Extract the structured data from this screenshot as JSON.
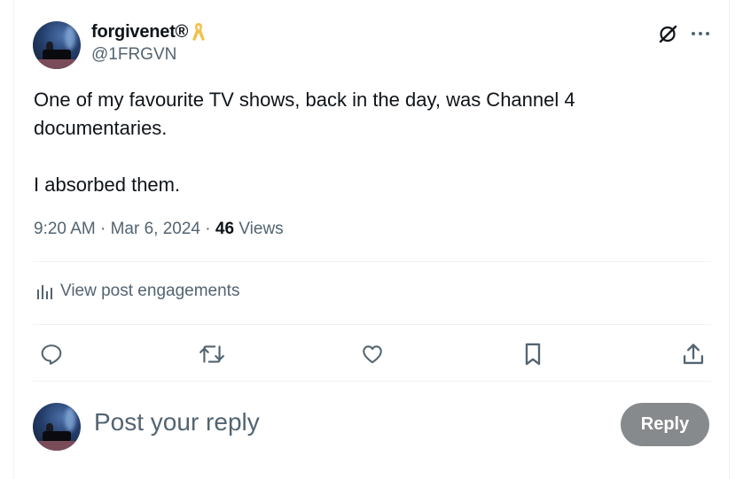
{
  "author": {
    "display_name": "forgivenet®",
    "handle": "@1FRGVN",
    "badge_icon": "yellow-ribbon-icon"
  },
  "post": {
    "lines": [
      "One of my favourite TV shows, back in the day, was Channel 4 documentaries.",
      "I absorbed them."
    ],
    "time": "9:20 AM",
    "date": "Mar 6, 2024",
    "views_count": "46",
    "views_label": "Views"
  },
  "engagements": {
    "label": "View post engagements",
    "icon": "analytics-icon"
  },
  "actions": [
    {
      "icon": "reply-icon"
    },
    {
      "icon": "repost-icon"
    },
    {
      "icon": "like-icon"
    },
    {
      "icon": "bookmark-icon"
    },
    {
      "icon": "share-icon"
    }
  ],
  "composer": {
    "placeholder": "Post your reply",
    "button_label": "Reply"
  },
  "colors": {
    "text_primary": "#0f1419",
    "text_secondary": "#536471",
    "divider": "#eff3f4",
    "button_disabled": "#878a8c",
    "ribbon": "#f2c14e"
  }
}
